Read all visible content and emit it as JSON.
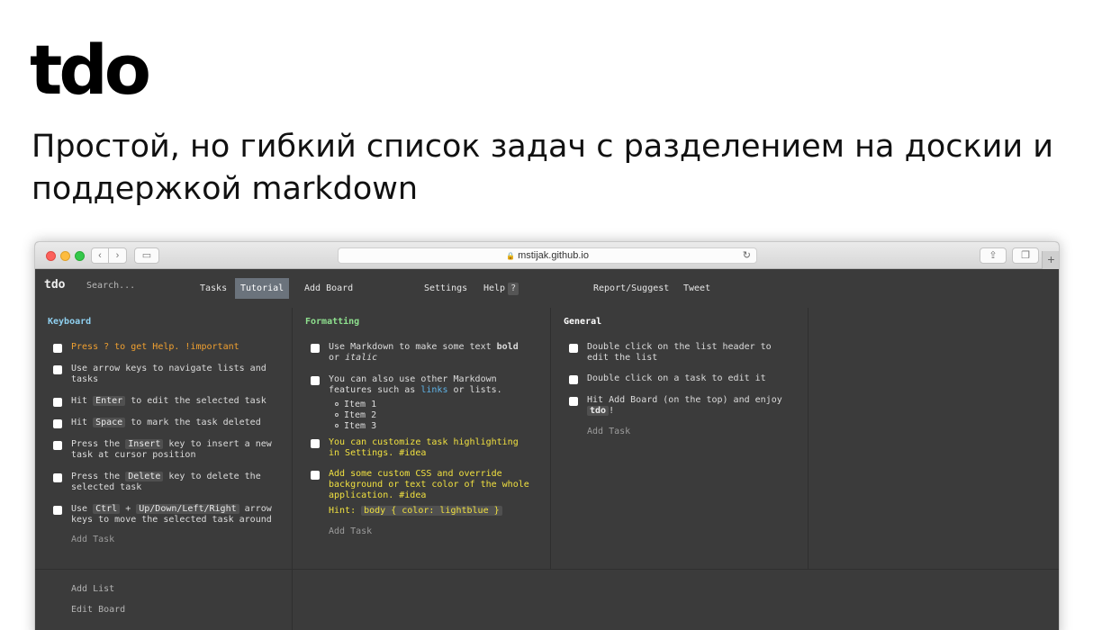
{
  "hero": {
    "logo": "tdo",
    "subtitle": "Простой, но гибкий список задач с разделением на доскии и поддержкой markdown"
  },
  "browser": {
    "url": "mstijak.github.io",
    "lock": "🔒",
    "nav_back": "‹",
    "nav_forward": "›",
    "sidebar_icon": "▭",
    "reload_icon": "↻",
    "share_icon": "⇪",
    "tabs_icon": "❐",
    "new_tab": "+"
  },
  "app": {
    "logo": "tdo",
    "search_placeholder": "Search...",
    "menu": {
      "tasks": "Tasks",
      "tutorial": "Tutorial",
      "add_board": "Add Board",
      "settings": "Settings",
      "help": "Help",
      "help_key": "?",
      "report": "Report/Suggest",
      "tweet": "Tweet"
    },
    "colors": {
      "background": "#3b3b3b",
      "active_tab": "#6b737c",
      "keyboard_title": "#8fd0f0",
      "formatting_title": "#8ee08e",
      "general_title": "#ffffff",
      "important": "#f0a030",
      "idea": "#f0e040",
      "link": "#5fb4e8"
    },
    "lists": {
      "keyboard": {
        "title": "Keyboard",
        "t1": "Press ? to get Help. !important",
        "t2": "Use arrow keys to navigate lists and tasks",
        "t3_a": "Hit ",
        "t3_key": "Enter",
        "t3_b": " to edit the selected task",
        "t4_a": "Hit ",
        "t4_key": "Space",
        "t4_b": " to mark the task deleted",
        "t5_a": "Press the ",
        "t5_key": "Insert",
        "t5_b": " key to insert a new task at cursor position",
        "t6_a": "Press the ",
        "t6_key": "Delete",
        "t6_b": " key to delete the selected task",
        "t7_a": "Use ",
        "t7_key1": "Ctrl",
        "t7_plus": " + ",
        "t7_key2": "Up/Down/Left/Right",
        "t7_b": " arrow keys to move the selected task around",
        "add_task": "Add Task"
      },
      "formatting": {
        "title": "Formatting",
        "t1_a": "Use Markdown to make some text ",
        "t1_bold": "bold",
        "t1_b": " or ",
        "t1_italic": "italic",
        "t2_a": "You can also use other Markdown features such as ",
        "t2_link": "links",
        "t2_b": " or lists.",
        "items": [
          "Item 1",
          "Item 2",
          "Item 3"
        ],
        "t3": "You can customize task highlighting in Settings. #idea",
        "t4": "Add some custom CSS and override background or text color of the whole application. #idea",
        "hint_label": "Hint: ",
        "hint_code": "body { color: lightblue }",
        "add_task": "Add Task"
      },
      "general": {
        "title": "General",
        "t1": "Double click on the list header to edit the list",
        "t2": "Double click on a task to edit it",
        "t3_a": "Hit Add Board (on the top) and enjoy ",
        "t3_code": "tdo",
        "t3_b": "!",
        "add_task": "Add Task"
      }
    },
    "bottom": {
      "add_list": "Add List",
      "edit_board": "Edit Board"
    }
  }
}
